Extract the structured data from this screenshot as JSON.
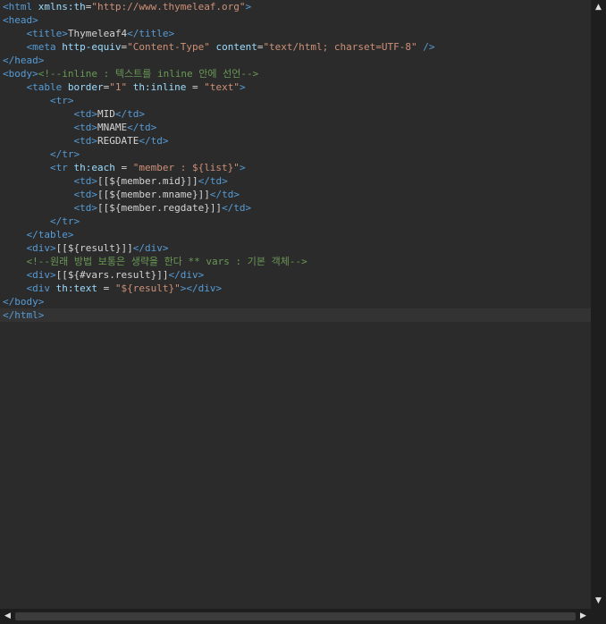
{
  "code_lines": [
    [
      {
        "t": "<html ",
        "c": "tag"
      },
      {
        "t": "xmlns:th",
        "c": "attr"
      },
      {
        "t": "=",
        "c": "txt"
      },
      {
        "t": "\"http://www.thymeleaf.org\"",
        "c": "val"
      },
      {
        "t": ">",
        "c": "tag"
      }
    ],
    [
      {
        "t": "<head>",
        "c": "tag"
      }
    ],
    [
      {
        "t": "    ",
        "c": "txt"
      },
      {
        "t": "<title>",
        "c": "tag"
      },
      {
        "t": "Thymeleaf4",
        "c": "txt"
      },
      {
        "t": "</title>",
        "c": "tag"
      }
    ],
    [
      {
        "t": "    ",
        "c": "txt"
      },
      {
        "t": "<meta ",
        "c": "tag"
      },
      {
        "t": "http-equiv",
        "c": "attr"
      },
      {
        "t": "=",
        "c": "txt"
      },
      {
        "t": "\"Content-Type\"",
        "c": "val"
      },
      {
        "t": " ",
        "c": "txt"
      },
      {
        "t": "content",
        "c": "attr"
      },
      {
        "t": "=",
        "c": "txt"
      },
      {
        "t": "\"text/html; charset=UTF-8\"",
        "c": "val"
      },
      {
        "t": " />",
        "c": "tag"
      }
    ],
    [
      {
        "t": "</head>",
        "c": "tag"
      }
    ],
    [
      {
        "t": "<body>",
        "c": "tag"
      },
      {
        "t": "<!--inline : 텍스트를 inline 안에 선언-->",
        "c": "cmt"
      }
    ],
    [
      {
        "t": "    ",
        "c": "txt"
      },
      {
        "t": "<table ",
        "c": "tag"
      },
      {
        "t": "border",
        "c": "attr"
      },
      {
        "t": "=",
        "c": "txt"
      },
      {
        "t": "\"1\"",
        "c": "val"
      },
      {
        "t": " ",
        "c": "txt"
      },
      {
        "t": "th:inline",
        "c": "attr"
      },
      {
        "t": " = ",
        "c": "txt"
      },
      {
        "t": "\"text\"",
        "c": "val"
      },
      {
        "t": ">",
        "c": "tag"
      }
    ],
    [
      {
        "t": "        ",
        "c": "txt"
      },
      {
        "t": "<tr>",
        "c": "tag"
      }
    ],
    [
      {
        "t": "            ",
        "c": "txt"
      },
      {
        "t": "<td>",
        "c": "tag"
      },
      {
        "t": "MID",
        "c": "txt"
      },
      {
        "t": "</td>",
        "c": "tag"
      }
    ],
    [
      {
        "t": "            ",
        "c": "txt"
      },
      {
        "t": "<td>",
        "c": "tag"
      },
      {
        "t": "MNAME",
        "c": "txt"
      },
      {
        "t": "</td>",
        "c": "tag"
      }
    ],
    [
      {
        "t": "            ",
        "c": "txt"
      },
      {
        "t": "<td>",
        "c": "tag"
      },
      {
        "t": "REGDATE",
        "c": "txt"
      },
      {
        "t": "</td>",
        "c": "tag"
      }
    ],
    [
      {
        "t": "        ",
        "c": "txt"
      },
      {
        "t": "</tr>",
        "c": "tag"
      }
    ],
    [
      {
        "t": "        ",
        "c": "txt"
      },
      {
        "t": "<tr ",
        "c": "tag"
      },
      {
        "t": "th:each",
        "c": "attr"
      },
      {
        "t": " = ",
        "c": "txt"
      },
      {
        "t": "\"member : ${list}\"",
        "c": "val"
      },
      {
        "t": ">",
        "c": "tag"
      }
    ],
    [
      {
        "t": "            ",
        "c": "txt"
      },
      {
        "t": "<td>",
        "c": "tag"
      },
      {
        "t": "[[${member.mid}]]",
        "c": "txt"
      },
      {
        "t": "</td>",
        "c": "tag"
      }
    ],
    [
      {
        "t": "            ",
        "c": "txt"
      },
      {
        "t": "<td>",
        "c": "tag"
      },
      {
        "t": "[[${member.mname}]]",
        "c": "txt"
      },
      {
        "t": "</td>",
        "c": "tag"
      }
    ],
    [
      {
        "t": "            ",
        "c": "txt"
      },
      {
        "t": "<td>",
        "c": "tag"
      },
      {
        "t": "[[${member.regdate}]]",
        "c": "txt"
      },
      {
        "t": "</td>",
        "c": "tag"
      }
    ],
    [
      {
        "t": "        ",
        "c": "txt"
      },
      {
        "t": "</tr>",
        "c": "tag"
      }
    ],
    [
      {
        "t": "    ",
        "c": "txt"
      },
      {
        "t": "</table>",
        "c": "tag"
      }
    ],
    [
      {
        "t": "    ",
        "c": "txt"
      },
      {
        "t": "<div>",
        "c": "tag"
      },
      {
        "t": "[[${result}]]",
        "c": "txt"
      },
      {
        "t": "</div>",
        "c": "tag"
      }
    ],
    [
      {
        "t": "    ",
        "c": "txt"
      },
      {
        "t": "<!--원래 방법 보통은 생략을 한다 ** vars : 기본 객체-->",
        "c": "cmt"
      }
    ],
    [
      {
        "t": "    ",
        "c": "txt"
      },
      {
        "t": "<div>",
        "c": "tag"
      },
      {
        "t": "[[${#vars.result}]]",
        "c": "txt"
      },
      {
        "t": "</div>",
        "c": "tag"
      }
    ],
    [
      {
        "t": "    ",
        "c": "txt"
      },
      {
        "t": "<div ",
        "c": "tag"
      },
      {
        "t": "th:text",
        "c": "attr"
      },
      {
        "t": " = ",
        "c": "txt"
      },
      {
        "t": "\"${result}\"",
        "c": "val"
      },
      {
        "t": "></div>",
        "c": "tag"
      }
    ],
    [
      {
        "t": "</body>",
        "c": "tag"
      }
    ],
    [
      {
        "t": "</html>",
        "c": "tag"
      }
    ]
  ],
  "current_line_index": 23,
  "scrollbars": {
    "up_arrow": "▲",
    "down_arrow": "▼",
    "left_arrow": "◀",
    "right_arrow": "▶"
  },
  "colors": {
    "background": "#2b2b2b",
    "tag": "#569cd6",
    "attribute": "#9cdcfe",
    "string": "#ce9178",
    "text": "#d4d4d4",
    "comment": "#6a9955"
  }
}
